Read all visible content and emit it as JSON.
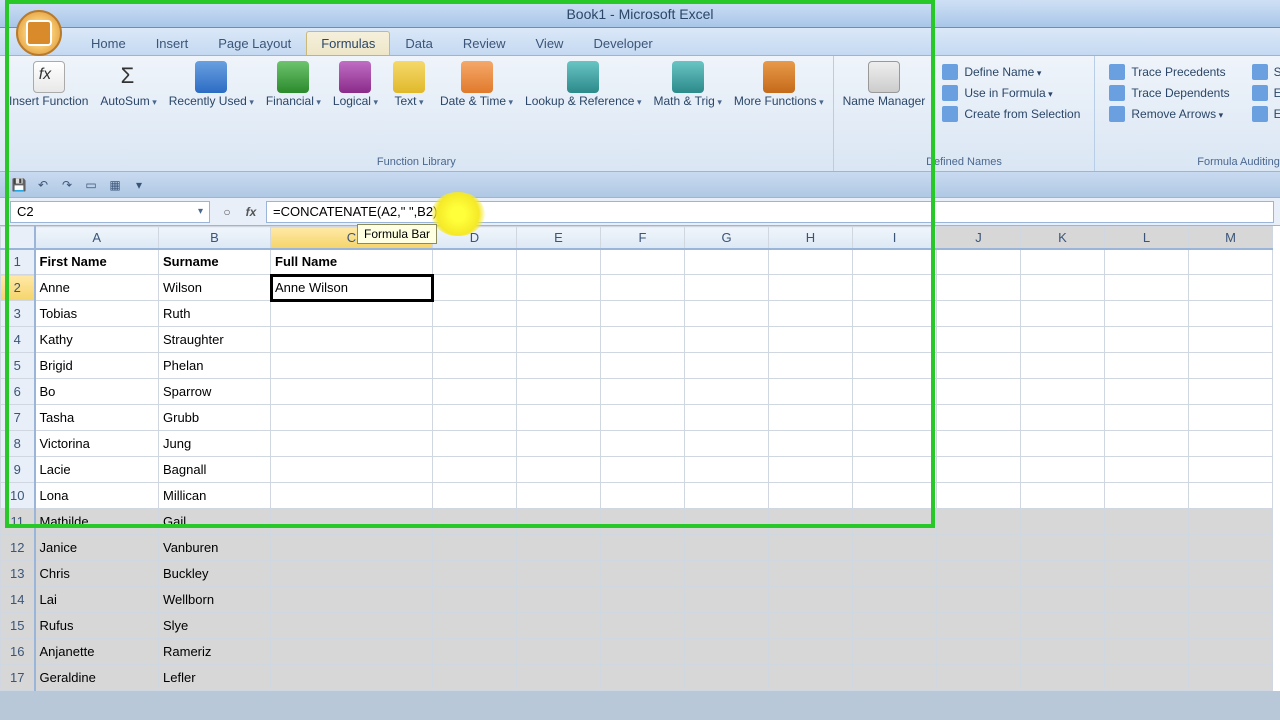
{
  "window": {
    "title": "Book1 - Microsoft Excel"
  },
  "tabs": {
    "home": "Home",
    "insert": "Insert",
    "pagelayout": "Page Layout",
    "formulas": "Formulas",
    "data": "Data",
    "review": "Review",
    "view": "View",
    "developer": "Developer"
  },
  "ribbon": {
    "function_library": {
      "label": "Function Library",
      "insert_function": "Insert\nFunction",
      "autosum": "AutoSum",
      "recently_used": "Recently\nUsed",
      "financial": "Financial",
      "logical": "Logical",
      "text": "Text",
      "date_time": "Date &\nTime",
      "lookup_ref": "Lookup &\nReference",
      "math_trig": "Math\n& Trig",
      "more_functions": "More\nFunctions"
    },
    "defined_names": {
      "label": "Defined Names",
      "name_manager": "Name\nManager",
      "define_name": "Define Name",
      "use_in_formula": "Use in Formula",
      "create_selection": "Create from Selection"
    },
    "formula_auditing": {
      "label": "Formula Auditing",
      "trace_precedents": "Trace Precedents",
      "trace_dependents": "Trace Dependents",
      "remove_arrows": "Remove Arrows",
      "show_formulas": "Show Formulas",
      "error_checking": "Error Checking",
      "evaluate_formula": "Evaluate Formula"
    }
  },
  "namebox": {
    "value": "C2"
  },
  "formula_bar": {
    "value": "=CONCATENATE(A2,\" \",B2)",
    "tooltip": "Formula Bar"
  },
  "columns": [
    "A",
    "B",
    "C",
    "D",
    "E",
    "F",
    "G",
    "H",
    "I",
    "J",
    "K",
    "L",
    "M"
  ],
  "headers": {
    "A": "First Name",
    "B": "Surname",
    "C": "Full Name"
  },
  "selected_cell": {
    "ref": "C2",
    "value": "Anne Wilson"
  },
  "rows": [
    {
      "n": 2,
      "a": "Anne",
      "b": "Wilson",
      "c": "Anne Wilson"
    },
    {
      "n": 3,
      "a": "Tobias",
      "b": "Ruth",
      "c": ""
    },
    {
      "n": 4,
      "a": "Kathy",
      "b": "Straughter",
      "c": ""
    },
    {
      "n": 5,
      "a": "Brigid",
      "b": "Phelan",
      "c": ""
    },
    {
      "n": 6,
      "a": "Bo",
      "b": "Sparrow",
      "c": ""
    },
    {
      "n": 7,
      "a": "Tasha",
      "b": "Grubb",
      "c": ""
    },
    {
      "n": 8,
      "a": "Victorina",
      "b": "Jung",
      "c": ""
    },
    {
      "n": 9,
      "a": "Lacie",
      "b": "Bagnall",
      "c": ""
    },
    {
      "n": 10,
      "a": "Lona",
      "b": "Millican",
      "c": ""
    },
    {
      "n": 11,
      "a": "Mathilde",
      "b": "Gail",
      "c": ""
    },
    {
      "n": 12,
      "a": "Janice",
      "b": "Vanburen",
      "c": ""
    },
    {
      "n": 13,
      "a": "Chris",
      "b": "Buckley",
      "c": ""
    },
    {
      "n": 14,
      "a": "Lai",
      "b": "Wellborn",
      "c": ""
    },
    {
      "n": 15,
      "a": "Rufus",
      "b": "Slye",
      "c": ""
    },
    {
      "n": 16,
      "a": "Anjanette",
      "b": "Rameriz",
      "c": ""
    },
    {
      "n": 17,
      "a": "Geraldine",
      "b": "Lefler",
      "c": ""
    }
  ]
}
